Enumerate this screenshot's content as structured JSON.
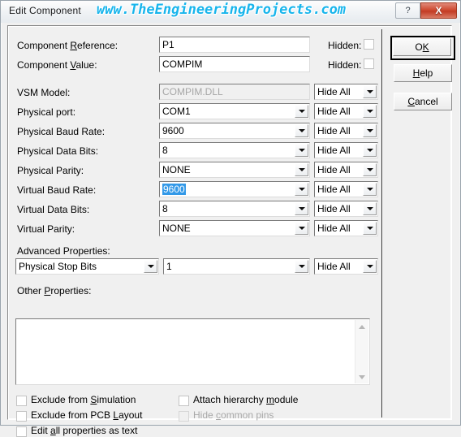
{
  "window": {
    "title": "Edit Component",
    "watermark": "www.TheEngineeringProjects.com",
    "help_button": "?",
    "close_button": "X",
    "accent_close": "#c23b24",
    "accent_watermark": "#18b5ec",
    "selection_color": "#3399e8"
  },
  "fields": {
    "reference": {
      "label_pre": "Component ",
      "label_key": "R",
      "label_post": "eference:",
      "value": "P1",
      "hidden_label": "Hidden:",
      "hidden_checked": false
    },
    "value": {
      "label_pre": "Component ",
      "label_key": "V",
      "label_post": "alue:",
      "value": "COMPIM",
      "hidden_label": "Hidden:",
      "hidden_checked": false
    }
  },
  "rows": [
    {
      "label": "VSM Model:",
      "value": "COMPIM.DLL",
      "disabled": true,
      "dropdown": false,
      "hide": "Hide All"
    },
    {
      "label": "Physical port:",
      "value": "COM1",
      "disabled": false,
      "dropdown": true,
      "hide": "Hide All"
    },
    {
      "label": "Physical Baud Rate:",
      "value": "9600",
      "disabled": false,
      "dropdown": true,
      "hide": "Hide All"
    },
    {
      "label": "Physical Data Bits:",
      "value": "8",
      "disabled": false,
      "dropdown": true,
      "hide": "Hide All"
    },
    {
      "label": "Physical Parity:",
      "value": "NONE",
      "disabled": false,
      "dropdown": true,
      "hide": "Hide All"
    },
    {
      "label": "Virtual Baud Rate:",
      "value": "9600",
      "disabled": false,
      "dropdown": true,
      "hide": "Hide All",
      "selected": true
    },
    {
      "label": "Virtual Data Bits:",
      "value": "8",
      "disabled": false,
      "dropdown": true,
      "hide": "Hide All"
    },
    {
      "label": "Virtual Parity:",
      "value": "NONE",
      "disabled": false,
      "dropdown": true,
      "hide": "Hide All"
    }
  ],
  "advanced": {
    "label": "Advanced Properties:",
    "property": "Physical Stop Bits",
    "value": "1",
    "hide": "Hide All"
  },
  "other_properties": {
    "label_pre": "Other ",
    "label_key": "P",
    "label_post": "roperties:",
    "value": ""
  },
  "checkboxes": [
    {
      "pre": "Exclude from ",
      "key": "S",
      "post": "imulation",
      "checked": false,
      "disabled": false
    },
    {
      "pre": "Exclude from PCB ",
      "key": "L",
      "post": "ayout",
      "checked": false,
      "disabled": false
    },
    {
      "pre": "Edit ",
      "key": "a",
      "post": "ll properties as text",
      "checked": false,
      "disabled": false
    },
    {
      "pre": "Attach hierarchy ",
      "key": "m",
      "post": "odule",
      "checked": false,
      "disabled": false
    },
    {
      "pre": "Hide ",
      "key": "c",
      "post": "ommon pins",
      "checked": false,
      "disabled": true
    }
  ],
  "buttons": {
    "ok": {
      "pre": "O",
      "key": "K",
      "post": ""
    },
    "help": {
      "pre": "",
      "key": "H",
      "post": "elp"
    },
    "cancel": {
      "pre": "",
      "key": "C",
      "post": "ancel"
    }
  }
}
